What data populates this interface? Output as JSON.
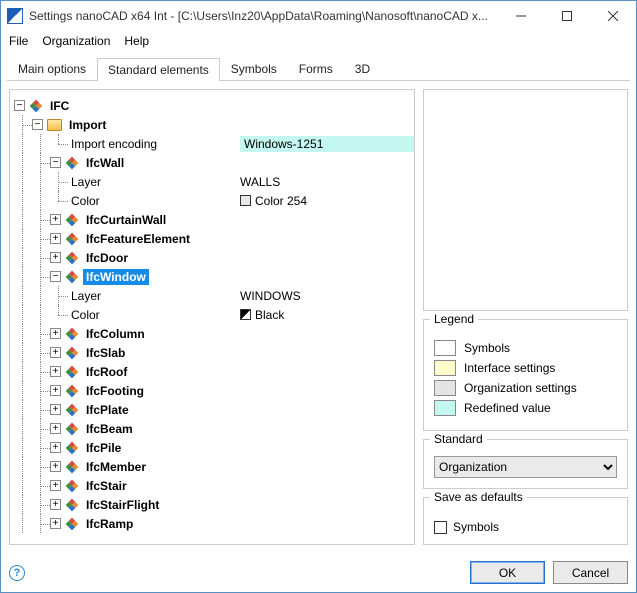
{
  "window": {
    "title": "Settings nanoCAD x64 Int - [C:\\Users\\Inz20\\AppData\\Roaming\\Nanosoft\\nanoCAD x..."
  },
  "menu": {
    "file": "File",
    "organization": "Organization",
    "help": "Help"
  },
  "tabs": {
    "main": "Main options",
    "standard": "Standard elements",
    "symbols": "Symbols",
    "forms": "Forms",
    "threeD": "3D"
  },
  "tree": {
    "root": "IFC",
    "import": "Import",
    "import_encoding_label": "Import encoding",
    "import_encoding_value": "Windows-1251",
    "ifcwall": "IfcWall",
    "ifcwall_layer_label": "Layer",
    "ifcwall_layer_value": "WALLS",
    "ifcwall_color_label": "Color",
    "ifcwall_color_value": "Color 254",
    "ifccurtainwall": "IfcCurtainWall",
    "ifcfeatureelement": "IfcFeatureElement",
    "ifcdoor": "IfcDoor",
    "ifcwindow": "IfcWindow",
    "ifcwindow_layer_label": "Layer",
    "ifcwindow_layer_value": "WINDOWS",
    "ifcwindow_color_label": "Color",
    "ifcwindow_color_value": "Black",
    "ifccolumn": "IfcColumn",
    "ifcslab": "IfcSlab",
    "ifcroof": "IfcRoof",
    "ifcfooting": "IfcFooting",
    "ifcplate": "IfcPlate",
    "ifcbeam": "IfcBeam",
    "ifcpile": "IfcPile",
    "ifcmember": "IfcMember",
    "ifcstair": "IfcStair",
    "ifcstairflight": "IfcStairFlight",
    "ifcramp": "IfcRamp"
  },
  "legend": {
    "title": "Legend",
    "symbols": "Symbols",
    "interface": "Interface settings",
    "organization": "Organization settings",
    "redefined": "Redefined value",
    "colors": {
      "symbols": "#ffffff",
      "interface": "#fdfccb",
      "organization": "#e4e4e4",
      "redefined": "#c3f7f0"
    }
  },
  "standard": {
    "title": "Standard",
    "value": "Organization"
  },
  "save_defaults": {
    "title": "Save as defaults",
    "symbols": "Symbols"
  },
  "buttons": {
    "ok": "OK",
    "cancel": "Cancel"
  }
}
